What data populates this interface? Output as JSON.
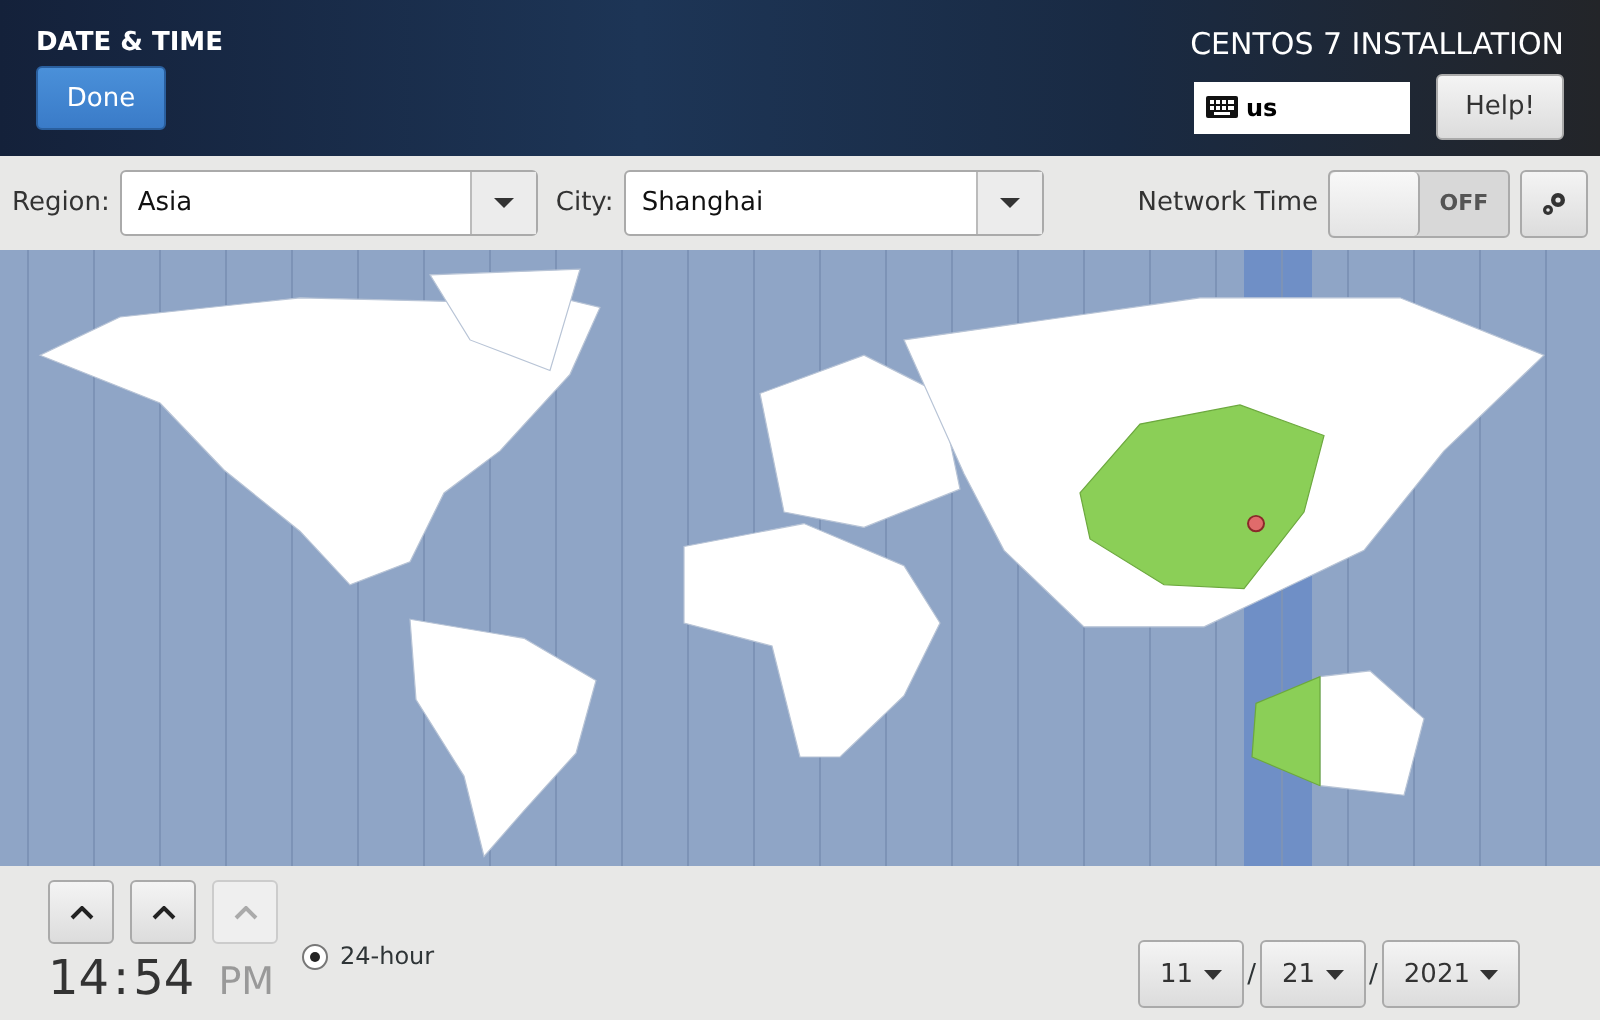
{
  "header": {
    "title": "DATE & TIME",
    "done_button": "Done",
    "product_title": "CENTOS 7 INSTALLATION",
    "keyboard_layout": "us",
    "help_button": "Help!"
  },
  "toolbar": {
    "region_label": "Region:",
    "region_value": "Asia",
    "city_label": "City:",
    "city_value": "Shanghai",
    "network_time_label": "Network Time",
    "network_time_toggle": {
      "on": false,
      "label": "OFF"
    }
  },
  "time": {
    "up_buttons": [
      {
        "disabled": false
      },
      {
        "disabled": false
      },
      {
        "disabled": true
      }
    ],
    "hours": "14",
    "separator": ":",
    "minutes": "54",
    "ampm": {
      "label": "PM",
      "disabled": true
    }
  },
  "time_format": [
    {
      "label": "24-hour",
      "selected": true
    }
  ],
  "date": [
    {
      "kind": "dropdown",
      "value": "11"
    },
    {
      "kind": "separator",
      "value": "/"
    },
    {
      "kind": "dropdown",
      "value": "21"
    },
    {
      "kind": "separator",
      "value": "/"
    },
    {
      "kind": "dropdown",
      "value": "2021"
    }
  ]
}
